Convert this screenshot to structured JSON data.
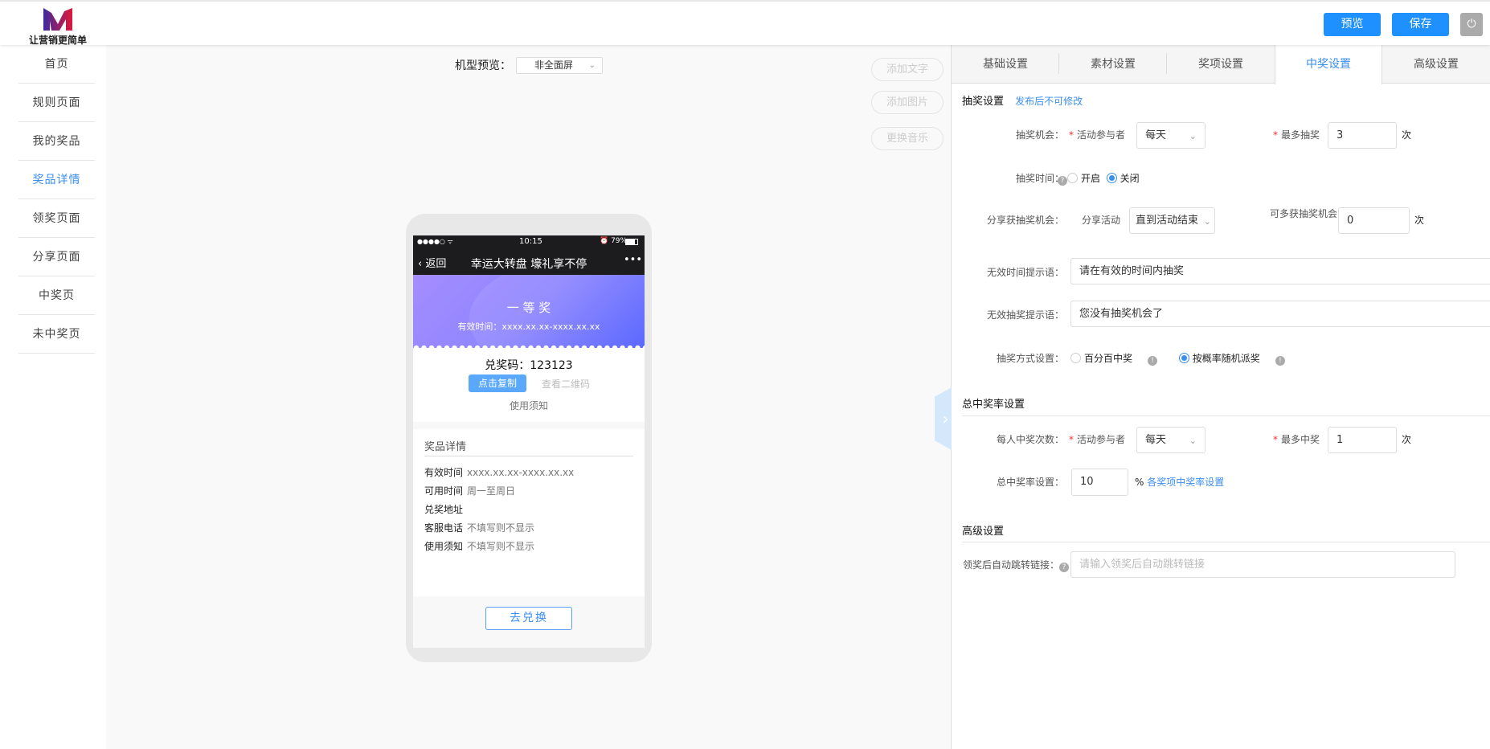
{
  "header": {
    "logo_text": "让营销更简单",
    "preview": "预览",
    "save": "保存",
    "power_icon": "⏻"
  },
  "sidebar": {
    "items": [
      "首页",
      "规则页面",
      "我的奖品",
      "奖品详情",
      "领奖页面",
      "分享页面",
      "中奖页",
      "未中奖页"
    ],
    "active": 3
  },
  "canvas": {
    "device_label": "机型预览：",
    "device_value": "非全面屏",
    "add_text": "添加文字",
    "add_image": "添加图片",
    "change_music": "更换音乐"
  },
  "phone": {
    "signal": "●●●●○ ᯤ",
    "time": "10:15",
    "battery": "⏰ 79%",
    "back": "返回",
    "title": "幸运大转盘 壕礼享不停",
    "more": "•••",
    "prize": "一 等 奖",
    "valid": "有效时间：xxxx.xx.xx-xxxx.xx.xx",
    "code": "兑奖码：123123",
    "copy": "点击复制",
    "qr": "查看二维码",
    "notice": "使用须知",
    "details_title": "奖品详情",
    "details": [
      {
        "k": "有效时间",
        "v": "xxxx.xx.xx-xxxx.xx.xx"
      },
      {
        "k": "可用时间",
        "v": "周一至周日"
      },
      {
        "k": "兑奖地址",
        "v": ""
      },
      {
        "k": "客服电话",
        "v": "不填写则不显示"
      },
      {
        "k": "使用须知",
        "v": "不填写则不显示"
      }
    ],
    "redeem": "去兑换"
  },
  "tabs": [
    "基础设置",
    "素材设置",
    "奖项设置",
    "中奖设置",
    "高级设置"
  ],
  "form": {
    "s1_title": "抽奖设置",
    "s1_note": "发布后不可修改",
    "chance_label": "抽奖机会：",
    "participant": "活动参与者",
    "freq": "每天",
    "max_draw_label": "最多抽奖",
    "max_draw": "3",
    "unit": "次",
    "time_label": "抽奖时间：",
    "on": "开启",
    "off": "关闭",
    "share_label": "分享获抽奖机会：",
    "share_act": "分享活动",
    "share_until": "直到活动结束",
    "extra_label": "可多获抽奖机会",
    "extra": "0",
    "invalid_time_label": "无效时间提示语：",
    "invalid_time": "请在有效的时间内抽奖",
    "invalid_draw_label": "无效抽奖提示语：",
    "invalid_draw": "您没有抽奖机会了",
    "mode_label": "抽奖方式设置：",
    "mode1": "百分百中奖",
    "mode2": "按概率随机派奖",
    "s2_title": "总中奖率设置",
    "per_label": "每人中奖次数：",
    "per_freq": "每天",
    "max_win_label": "最多中奖",
    "max_win": "1",
    "rate_label": "总中奖率设置：",
    "rate": "10",
    "pct": "%",
    "rate_link": "各奖项中奖率设置",
    "s3_title": "高级设置",
    "redirect_label": "领奖后自动跳转链接：",
    "redirect_ph": "请输入领奖后自动跳转链接"
  },
  "colors": {
    "accent": "#1e90ff",
    "link": "#3a8ef0"
  }
}
